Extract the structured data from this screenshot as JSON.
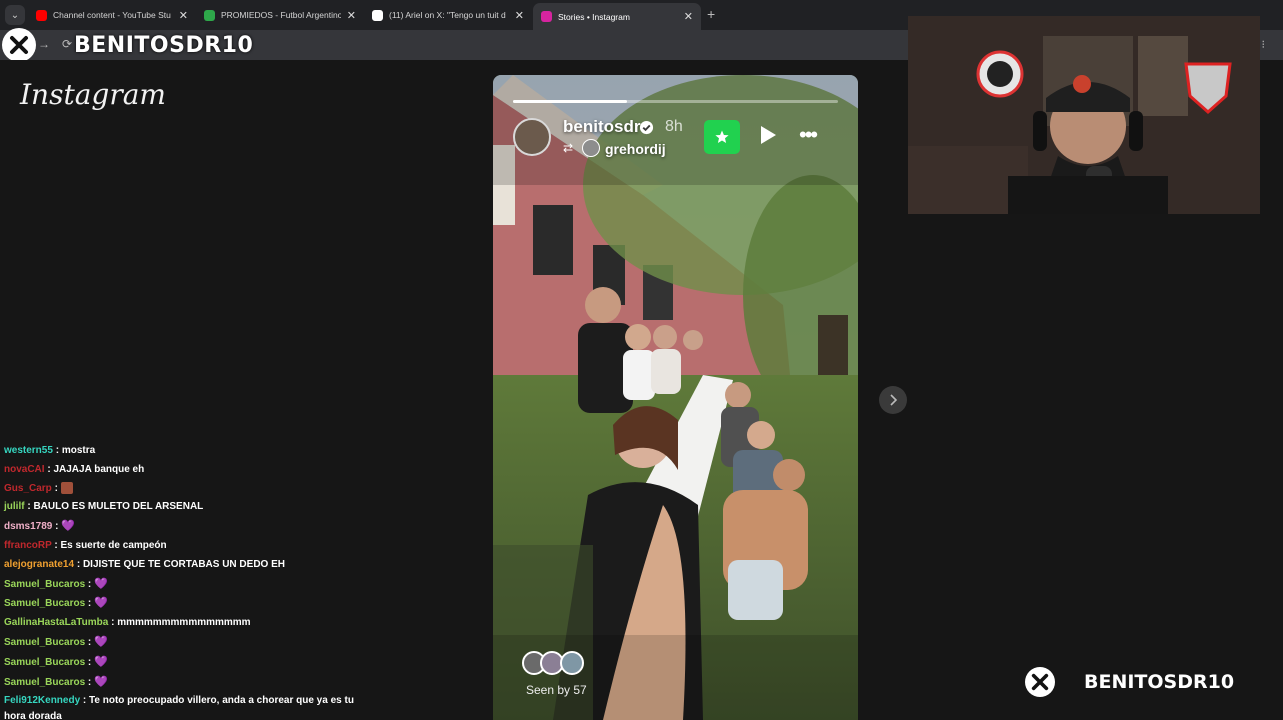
{
  "browser": {
    "tabs": [
      {
        "label": "Channel content - YouTube Stu",
        "favicon_color": "#ff0000",
        "active": false
      },
      {
        "label": "PROMIEDOS - Futbol Argentino",
        "favicon_color": "#2ea84a",
        "active": false
      },
      {
        "label": "(11) Ariel on X: \"Tengo un tuit d",
        "favicon_color": "#ffffff",
        "active": false
      },
      {
        "label": "Stories • Instagram",
        "favicon_color": "#d6249f",
        "active": true
      }
    ],
    "close_glyph": "✕",
    "new_tab_glyph": "+"
  },
  "overlay": {
    "top_name": "BENITOSDR10",
    "bottom_name": "BENITOSDR10"
  },
  "instagram": {
    "logo_text": "Instagram"
  },
  "story": {
    "username": "benitosdr",
    "time": "8h",
    "original_user": "grehordij",
    "seen_by": "Seen by 57",
    "progress": 0.35,
    "accent_close_friends": "#21d14f"
  },
  "chat": {
    "messages": [
      {
        "user": "western55",
        "color": "#36d6c0",
        "text": "mostra"
      },
      {
        "user": "novaCAI",
        "color": "#c0282d",
        "text": "JAJAJA banque eh"
      },
      {
        "user": "Gus_Carp",
        "color": "#c0282d",
        "text": "",
        "emote": "image"
      },
      {
        "user": "julilf",
        "color": "#9ad65a",
        "text": "BAULO ES MULETO DEL ARSENAL"
      },
      {
        "user": "dsms1789",
        "color": "#f0b0c8",
        "text": "",
        "emote": "heart"
      },
      {
        "user": "ffrancoRP",
        "color": "#c0282d",
        "text": "Es suerte de campeón"
      },
      {
        "user": "alejogranate14",
        "color": "#f0a030",
        "text": "DIJISTE QUE TE CORTABAS UN DEDO EH"
      },
      {
        "user": "Samuel_Bucaros",
        "color": "#9ad65a",
        "text": "",
        "emote": "heart"
      },
      {
        "user": "Samuel_Bucaros",
        "color": "#9ad65a",
        "text": "",
        "emote": "heart"
      },
      {
        "user": "GallinaHastaLaTumba",
        "color": "#9ad65a",
        "text": "mmmmmmmmmmmmmmm"
      },
      {
        "user": "Samuel_Bucaros",
        "color": "#9ad65a",
        "text": "",
        "emote": "heart"
      },
      {
        "user": "Samuel_Bucaros",
        "color": "#9ad65a",
        "text": "",
        "emote": "heart"
      },
      {
        "user": "Samuel_Bucaros",
        "color": "#9ad65a",
        "text": "",
        "emote": "heart"
      },
      {
        "user": "Feli912Kennedy",
        "color": "#36d6c0",
        "text": "Te noto preocupado villero, anda a chorear que ya es tu hora dorada"
      }
    ]
  }
}
